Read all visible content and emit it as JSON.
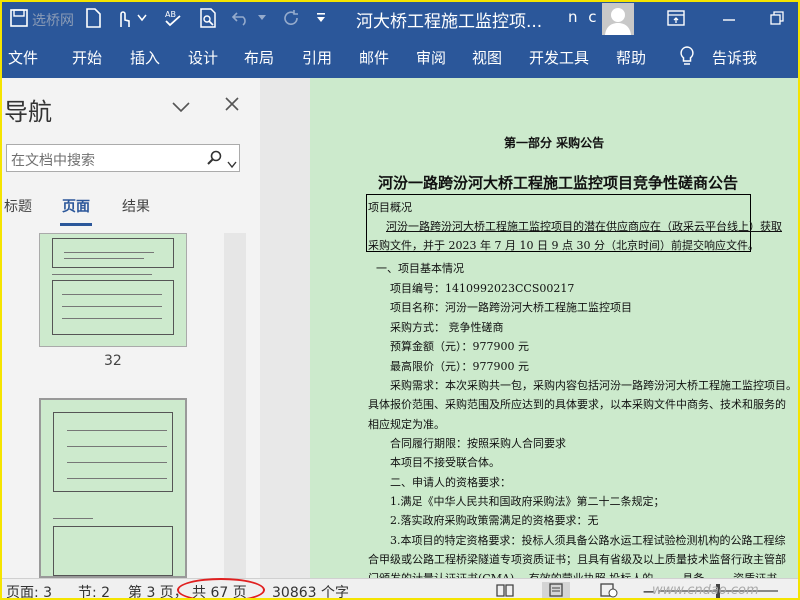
{
  "title_bar": {
    "document_title": "河大桥工程施工监控项...",
    "user_initials": "n c",
    "quick_icons": [
      "save-icon",
      "new-doc-icon",
      "touch-mode-icon",
      "customize-icon",
      "spelling-icon",
      "print-preview-icon",
      "undo-icon",
      "redo-icon",
      "more-icon"
    ],
    "overlay_text": "选桥网"
  },
  "ribbon": {
    "tabs": [
      "文件",
      "开始",
      "插入",
      "设计",
      "布局",
      "引用",
      "邮件",
      "审阅",
      "视图",
      "开发工具",
      "帮助"
    ],
    "tell_me": "告诉我"
  },
  "navigation": {
    "title": "导航",
    "search_placeholder": "在文档中搜索",
    "tabs": [
      "标题",
      "页面",
      "结果"
    ],
    "active_tab": "页面",
    "page_label": "32"
  },
  "document": {
    "section_heading": "第一部分 采购公告",
    "main_title": "河汾一路跨汾河大桥工程施工监控项目竞争性磋商公告",
    "lines": [
      "项目概况",
      "河汾一路跨汾河大桥工程施工监控项目的潜在供应商应在（政采云平台线上）获取",
      "采购文件，并于 2023 年 7 月 10 日 9 点 30 分（北京时间）前提交响应文件。",
      "一、项目基本情况",
      "项目编号：1410992023CCS00217",
      "项目名称：河汾一路跨汾河大桥工程施工监控项目",
      "采购方式： 竞争性磋商",
      "预算金额（元）：977900 元",
      "最高限价（元）：977900 元",
      "采购需求：本次采购共一包，采购内容包括河汾一路跨汾河大桥工程施工监控项目。",
      "具体报价范围、采购范围及所应达到的具体要求，以本采购文件中商务、技术和服务的",
      "相应规定为准。",
      "合同履行期限：按照采购人合同要求",
      "本项目不接受联合体。",
      "二、申请人的资格要求：",
      "1.满足《中华人民共和国政府采购法》第二十二条规定；",
      "2.落实政府采购政策需满足的资格要求：无",
      "3.本项目的特定资格要求：投标人须具备公路水运工程试验检测机构的公路工程综",
      "合甲级或公路工程桥梁隧道专项资质证书；且具有省级及以上质量技术监督行政主管部",
      "门颁发的计量认证证书(CMA)。  有效的营业执照   投标人的 …… 具备 …… 资质证书"
    ]
  },
  "status_bar": {
    "page": "页面: 3",
    "section": "节: 2",
    "page_of": "第 3 页，",
    "total_pages": "共 67 页",
    "word_count": "30863 个字",
    "watermark": "www.cndao.com"
  }
}
